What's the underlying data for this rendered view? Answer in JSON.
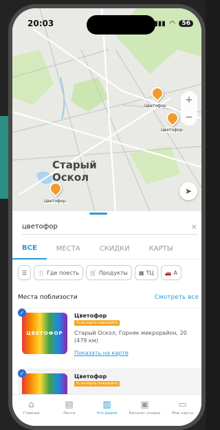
{
  "status": {
    "time": "20:03",
    "battery": "56"
  },
  "map": {
    "city_line1": "Старый",
    "city_line2": "Оскол",
    "pins": [
      {
        "label": "Цветофор"
      },
      {
        "label": "Цветофор"
      },
      {
        "label": "Цветофор"
      }
    ],
    "zoom_in": "+",
    "zoom_out": "−"
  },
  "search": {
    "value": "цветофор",
    "clear": "×"
  },
  "tabs": [
    "ВСЕ",
    "МЕСТА",
    "СКИДКИ",
    "КАРТЫ"
  ],
  "chips": [
    {
      "icon": "filter-icon",
      "label": ""
    },
    {
      "icon": "fork-knife-icon",
      "label": "Где поесть"
    },
    {
      "icon": "cart-icon",
      "label": "Продукты"
    },
    {
      "icon": "mall-icon",
      "label": "ТЦ"
    },
    {
      "icon": "car-icon",
      "label": "А"
    }
  ],
  "section": {
    "title": "Места поблизости",
    "see_all": "Смотреть все"
  },
  "places": [
    {
      "name": "Цветофор",
      "badge": "% на карте пожалуйте",
      "address": "Старый Оскол, Горняк микрорайон, 20 (479 км)",
      "action": "Показать на карте",
      "logo_text": "ЦВЕТОФОР"
    },
    {
      "name": "Цветофор",
      "badge": "% на карте пожалуйте",
      "address": "",
      "action": "",
      "logo_text": ""
    }
  ],
  "nav": [
    {
      "icon": "home-icon",
      "label": "Главная",
      "active": false
    },
    {
      "icon": "feed-icon",
      "label": "Лента",
      "active": false
    },
    {
      "icon": "map-icon",
      "label": "Что рядом",
      "active": true
    },
    {
      "icon": "catalog-icon",
      "label": "Каталог скидок",
      "active": false
    },
    {
      "icon": "cards-icon",
      "label": "Мои карты",
      "active": false
    }
  ],
  "colors": {
    "accent": "#2a9ad6",
    "pin": "#f29b2c",
    "badge": "#f5a623"
  }
}
